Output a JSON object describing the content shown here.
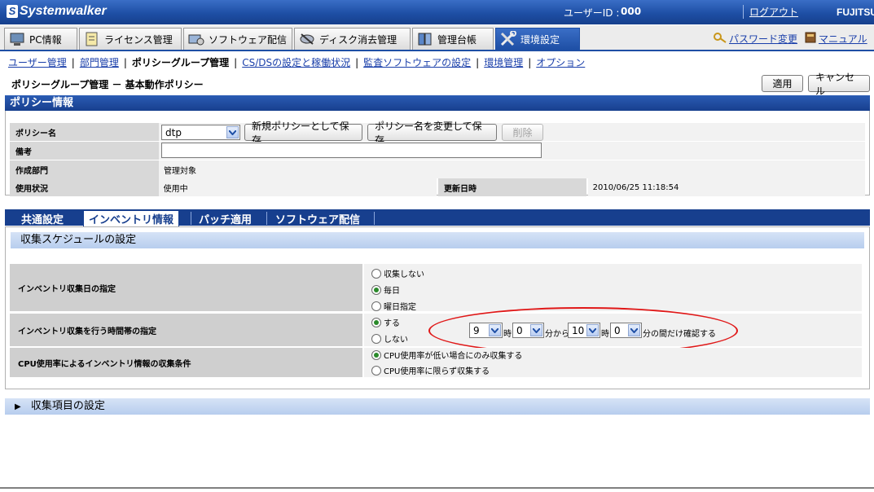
{
  "header": {
    "logo": "Systemwalker",
    "user_label": "ユーザーID :",
    "user_id": "000",
    "logout": "ログアウト",
    "brand": "FUJITSU"
  },
  "main_tabs": [
    {
      "label": "PC情報",
      "icon": "pc-icon"
    },
    {
      "label": "ライセンス管理",
      "icon": "license-icon"
    },
    {
      "label": "ソフトウェア配信",
      "icon": "software-icon"
    },
    {
      "label": "ディスク消去管理",
      "icon": "disk-icon"
    },
    {
      "label": "管理台帳",
      "icon": "ledger-icon"
    },
    {
      "label": "環境設定",
      "icon": "tools-icon",
      "active": true
    }
  ],
  "links": {
    "password": "パスワード変更",
    "manual": "マニュアル"
  },
  "subnav": [
    {
      "label": "ユーザー管理",
      "link": true
    },
    {
      "label": "部門管理",
      "link": true
    },
    {
      "label": "ポリシーグループ管理",
      "link": false
    },
    {
      "label": "CS/DSの設定と稼働状況",
      "link": true
    },
    {
      "label": "監査ソフトウェアの設定",
      "link": true
    },
    {
      "label": "環境管理",
      "link": true
    },
    {
      "label": "オプション",
      "link": true
    }
  ],
  "page": {
    "title": "ポリシーグループ管理 － 基本動作ポリシー",
    "apply": "適用",
    "cancel": "キャンセル"
  },
  "policy_info": {
    "heading": "ポリシー情報",
    "name_label": "ポリシー名",
    "name_value": "dtp",
    "save_new": "新規ポリシーとして保存",
    "rename_save": "ポリシー名を変更して保存",
    "delete": "削除",
    "remarks_label": "備考",
    "dept_label": "作成部門",
    "dept_value": "管理対象",
    "status_label": "使用状況",
    "status_value": "使用中",
    "updated_label": "更新日時",
    "updated_value": "2010/06/25 11:18:54"
  },
  "sub_tabs": [
    "共通設定",
    "インベントリ情報",
    "パッチ適用",
    "ソフトウェア配信"
  ],
  "schedule": {
    "heading": "収集スケジュールの設定",
    "day_label": "インベントリ収集日の指定",
    "day_options": [
      "収集しない",
      "毎日",
      "曜日指定"
    ],
    "time_label": "インベントリ収集を行う時間帯の指定",
    "time_options": [
      "する",
      "しない"
    ],
    "from_hour": "9",
    "from_min": "0",
    "to_hour": "10",
    "to_min": "0",
    "hour_unit": "時",
    "min_from": "分から",
    "min_to": "分の間だけ確認する",
    "cpu_label": "CPU使用率によるインベントリ情報の収集条件",
    "cpu_options": [
      "CPU使用率が低い場合にのみ収集する",
      "CPU使用率に限らず収集する"
    ]
  },
  "collect_items": {
    "heading": "収集項目の設定"
  },
  "colors": {
    "header_blue": "#1e4fa5",
    "annotation_red": "#e01818"
  }
}
